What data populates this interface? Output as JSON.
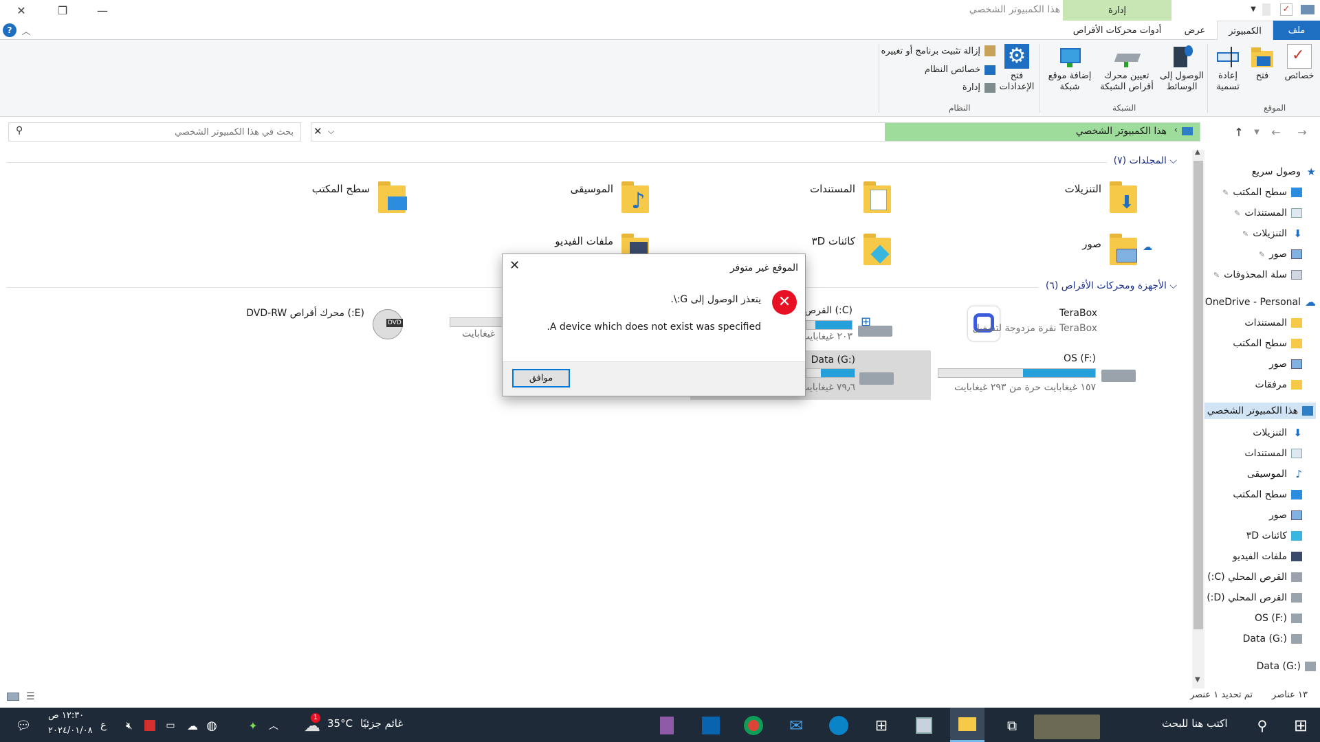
{
  "window": {
    "title": "هذا الكمبيوتر الشخصي",
    "manage_tab": "إدارة",
    "drive_tools_tab": "أدوات محركات الأقراص"
  },
  "tabs": {
    "file": "ملف",
    "computer": "الكمبيوتر",
    "view": "عرض"
  },
  "ribbon": {
    "properties": "خصائص",
    "open": "فتح",
    "rename": "إعادة تسمية",
    "access_media_1": "الوصول إلى",
    "access_media_2": "الوسائط",
    "map_drive_1": "تعيين محرك",
    "map_drive_2": "أقراص الشبكة",
    "add_location_1": "إضافة موقع",
    "add_location_2": "شبكة",
    "open_settings_1": "فتح",
    "open_settings_2": "الإعدادات",
    "uninstall": "إزالة تثبيت برنامج أو تغييره",
    "system_props": "خصائص النظام",
    "manage": "إدارة",
    "group_location": "الموقع",
    "group_network": "الشبكة",
    "group_system": "النظام"
  },
  "address": {
    "path": "هذا الكمبيوتر الشخصي",
    "search_placeholder": "بحث في هذا الكمبيوتر الشخصي"
  },
  "nav": {
    "quick_access": "وصول سريع",
    "desktop": "سطح المكتب",
    "documents": "المستندات",
    "downloads": "التنزيلات",
    "pictures": "صور",
    "recycle": "سلة المحذوفات",
    "onedrive": "OneDrive - Personal",
    "od_documents": "المستندات",
    "od_desktop": "سطح المكتب",
    "od_pictures": "صور",
    "od_attachments": "مرفقات",
    "this_pc": "هذا الكمبيوتر الشخصي",
    "pc_downloads": "التنزيلات",
    "pc_documents": "المستندات",
    "pc_music": "الموسيقى",
    "pc_desktop": "سطح المكتب",
    "pc_pictures": "صور",
    "pc_3d": "كائنات ٣D",
    "pc_videos": "ملفات الفيديو",
    "local_c": "القرص المحلي (C:)",
    "local_d": "القرص المحلي (D:)",
    "os_f": "OS (F:)",
    "data_g": "Data (G:)",
    "data_g2": "Data (G:)"
  },
  "content": {
    "folders_header": "المجلدات (٧)",
    "devices_header": "الأجهزة ومحركات الأقراص (٦)",
    "folders": {
      "downloads": "التنزيلات",
      "documents": "المستندات",
      "music": "الموسيقى",
      "desktop": "سطح المكتب",
      "pictures": "صور",
      "objects3d": "كائنات ٣D",
      "videos": "ملفات الفيديو"
    },
    "drives": {
      "terabox_name": "TeraBox",
      "terabox_sub": "TeraBox نقرة مزدوجة لتشغيل",
      "c_name": "(C:) القرص",
      "c_sub": "٢٠٣ غيغابايت",
      "dvd_name": "(E:) محرك أقراص DVD-RW",
      "d_sub": "غيغابايت",
      "f_name": "OS (F:)",
      "f_sub": "١٥٧ غيغابايت حرة من ٢٩٣ غيغابايت",
      "g_name": "Data (G:)",
      "g_sub": "٧٩٫٦ غيغابايت"
    }
  },
  "status": {
    "count": "١٣ عناصر",
    "selected": "تم تحديد ١ عنصر"
  },
  "dialog": {
    "title": "الموقع غير متوفر",
    "line1": "يتعذر الوصول إلى G:\\.",
    "line2": "A device which does not exist was specified.",
    "ok": "موافق"
  },
  "taskbar": {
    "search_placeholder": "اكتب هنا للبحث",
    "weather_temp": "35°C",
    "weather_desc": "غائم جزئيًا",
    "time": "١٢:٣٠ ص",
    "date": "٢٠٢٤/٠١/٠٨",
    "lang": "ع",
    "weather_badge": "1"
  },
  "usage": {
    "c": 0.8,
    "f": 0.46,
    "g": 0.7,
    "d": 0.1
  },
  "colors": {
    "accent": "#1e6fc1",
    "manage_tab": "#c8e6b4",
    "address_fill": "#9ddc9a",
    "bar_fill": "#26a0da",
    "error": "#e81123"
  }
}
